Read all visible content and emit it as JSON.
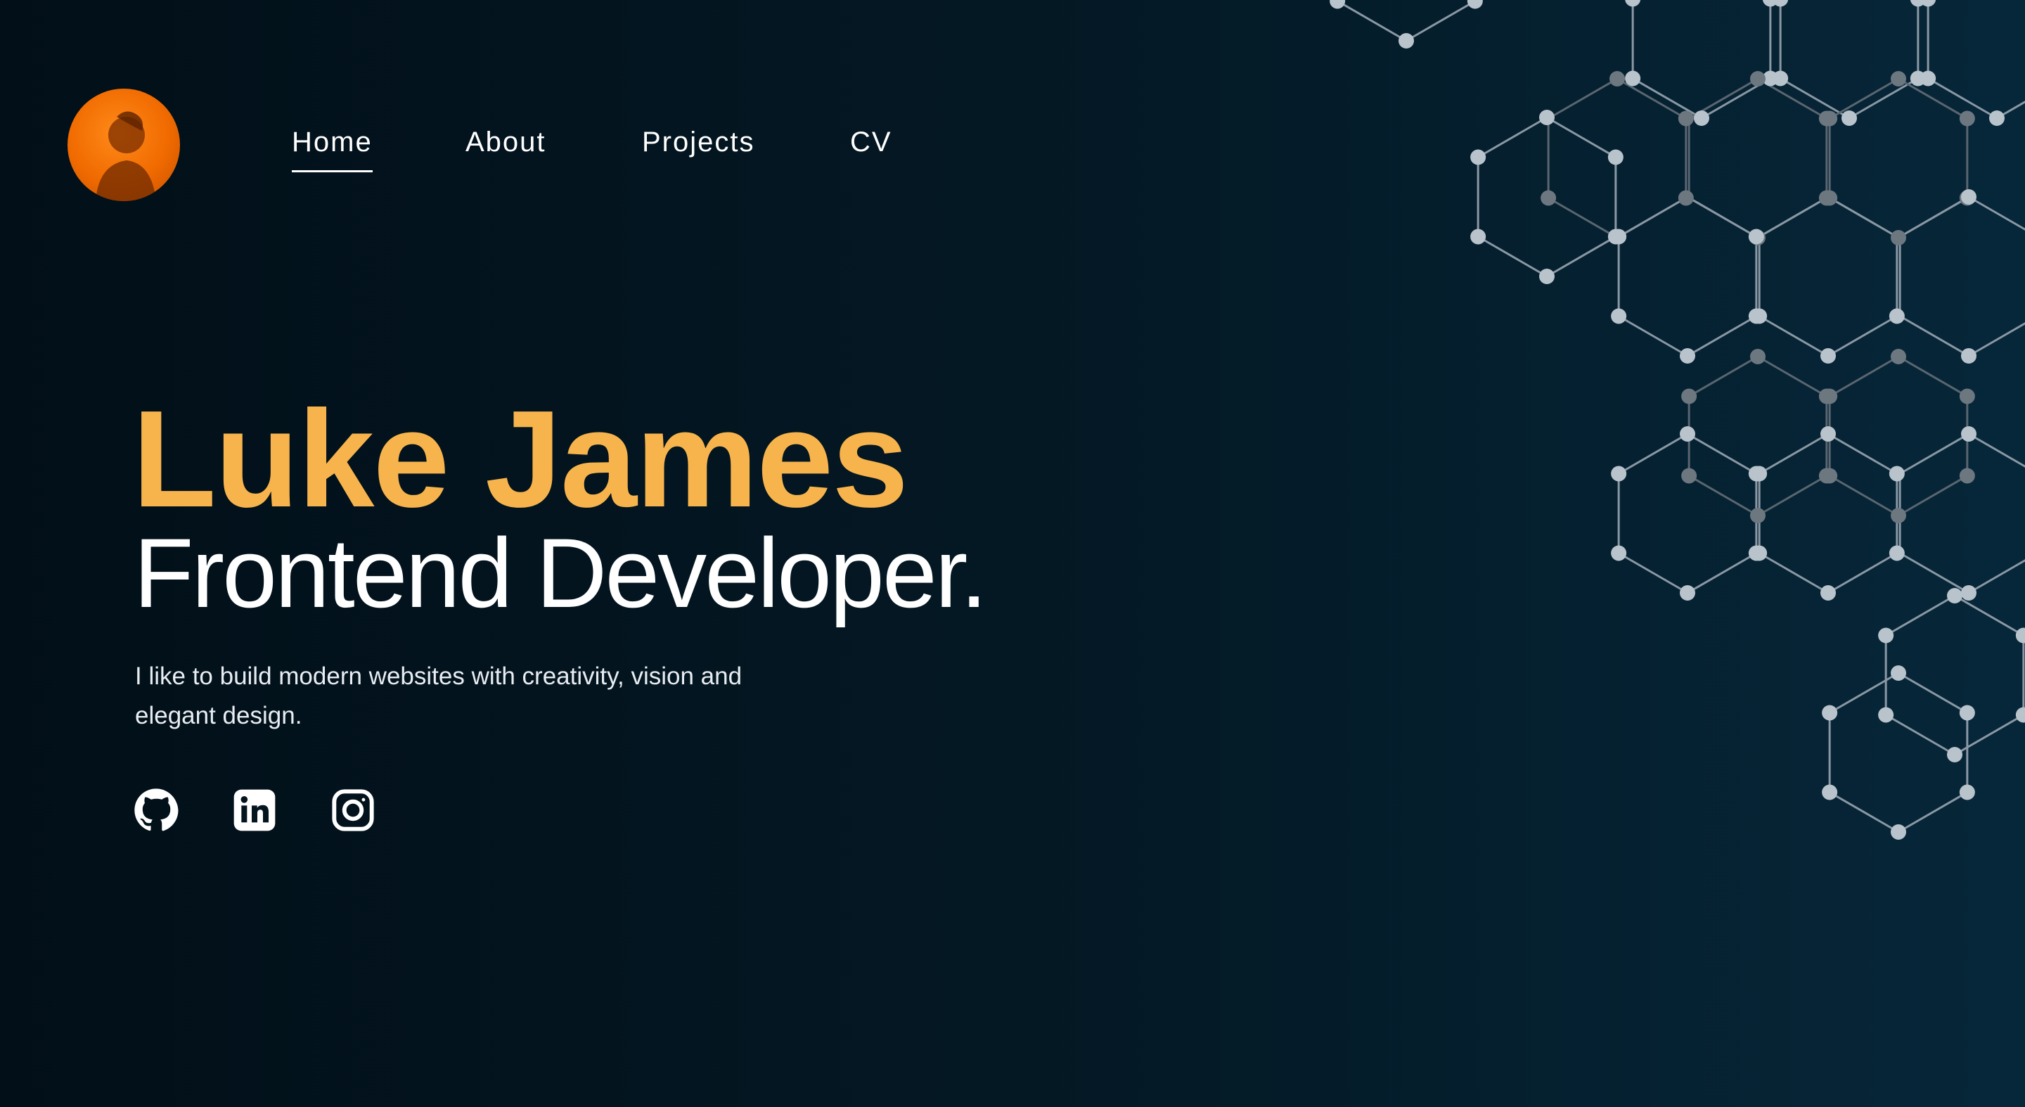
{
  "profile": {
    "avatar_icon": "person-silhouette-avatar"
  },
  "nav": {
    "items": [
      {
        "label": "Home",
        "active": true
      },
      {
        "label": "About",
        "active": false
      },
      {
        "label": "Projects",
        "active": false
      },
      {
        "label": "CV",
        "active": false
      }
    ]
  },
  "hero": {
    "name": "Luke James",
    "role": "Frontend Developer.",
    "description": "I like to build modern websites with creativity, vision and elegant design."
  },
  "socials": [
    {
      "name": "github-icon"
    },
    {
      "name": "linkedin-icon"
    },
    {
      "name": "instagram-icon"
    }
  ],
  "colors": {
    "accent": "#f8b44c",
    "background_dark": "#020f18",
    "background_right": "#06273a",
    "avatar_orange": "#f06a00"
  }
}
